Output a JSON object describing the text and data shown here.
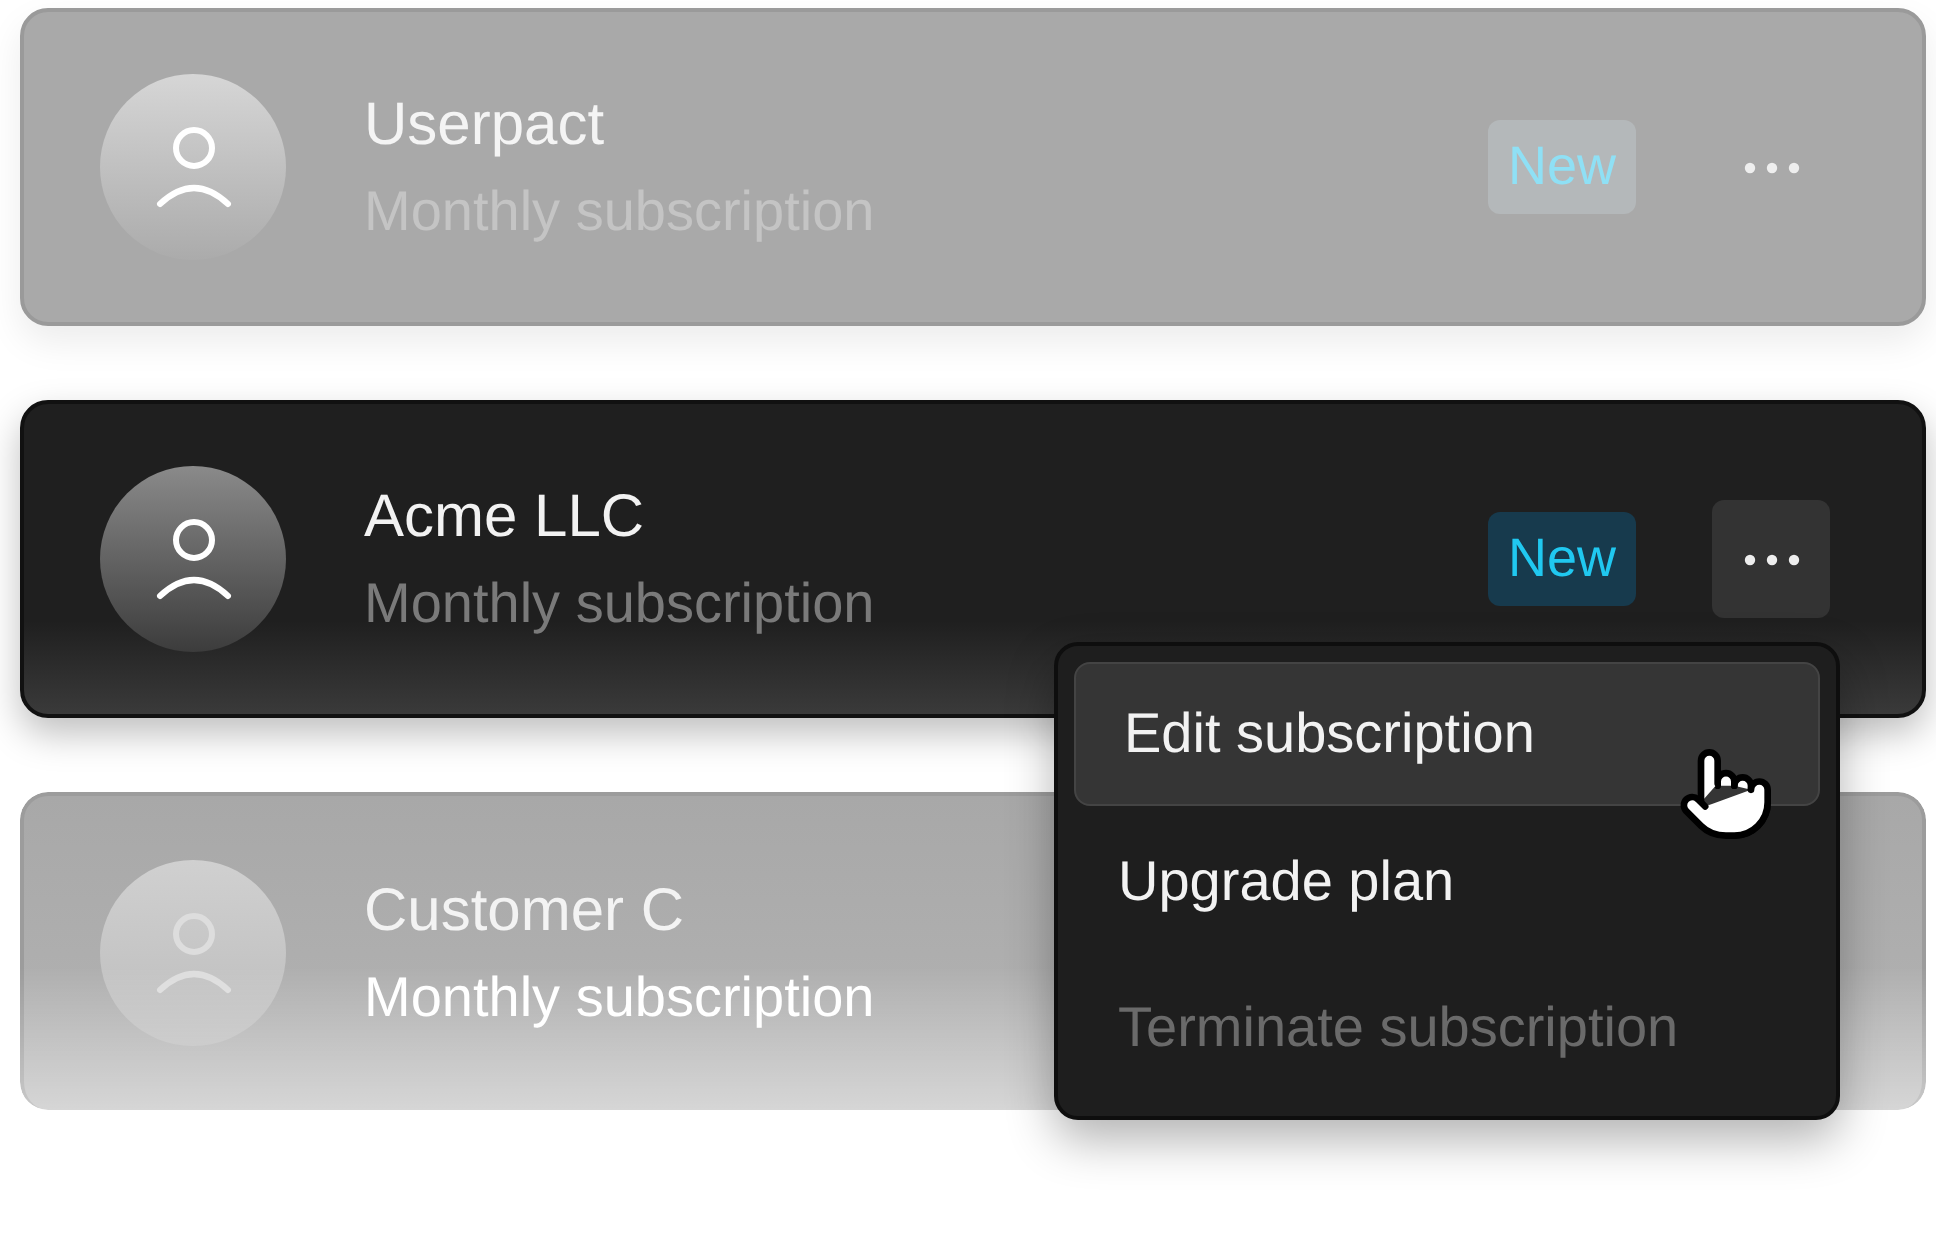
{
  "rows": [
    {
      "kind": "muted",
      "name": "Userpact",
      "subtitle": "Monthly subscription",
      "badge": "New",
      "menu_open": false
    },
    {
      "kind": "active",
      "name": "Acme LLC",
      "subtitle": "Monthly subscription",
      "badge": "New",
      "menu_open": true
    },
    {
      "kind": "fading",
      "name": "Customer  C",
      "subtitle": "Monthly subscription"
    }
  ],
  "menu": {
    "items": [
      {
        "label": "Edit subscription",
        "selected": true,
        "disabled": false
      },
      {
        "label": "Upgrade plan",
        "selected": false,
        "disabled": false
      },
      {
        "label": "Terminate subscription",
        "selected": false,
        "disabled": true
      }
    ]
  }
}
